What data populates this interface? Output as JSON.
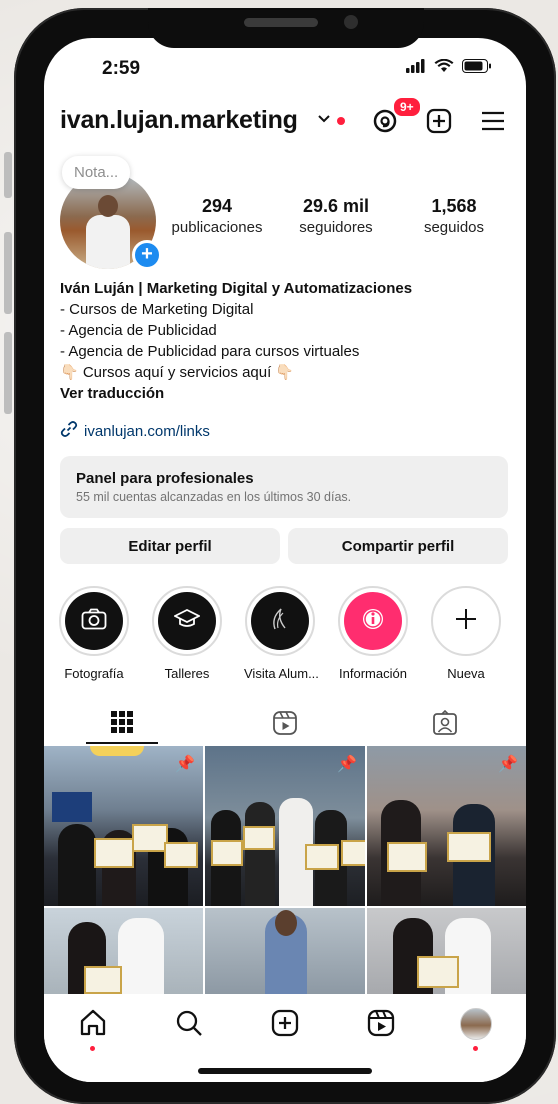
{
  "status_bar": {
    "time": "2:59"
  },
  "header": {
    "username": "ivan.lujan.marketing",
    "threads_badge": "9+"
  },
  "profile": {
    "note_placeholder": "Nota...",
    "stats": [
      {
        "value": "294",
        "label": "publicaciones"
      },
      {
        "value": "29.6 mil",
        "label": "seguidores"
      },
      {
        "value": "1,568",
        "label": "seguidos"
      }
    ],
    "bio": {
      "name": "Iván Luján | Marketing Digital y Automatizaciones",
      "lines": [
        "- Cursos de Marketing Digital",
        "- Agencia de Publicidad",
        "- Agencia de Publicidad para cursos virtuales",
        "👇🏻 Cursos aquí y servicios aquí 👇🏻"
      ],
      "translate": "Ver traducción"
    },
    "link": "ivanlujan.com/links"
  },
  "panel": {
    "title": "Panel para profesionales",
    "subtitle": "55 mil cuentas alcanzadas en los últimos 30 días."
  },
  "buttons": {
    "edit": "Editar perfil",
    "share": "Compartir perfil"
  },
  "highlights": [
    {
      "label": "Fotografía",
      "icon": "camera-icon"
    },
    {
      "label": "Talleres",
      "icon": "graduation-cap-icon"
    },
    {
      "label": "Visita Alum...",
      "icon": "feather-icon"
    },
    {
      "label": "Información",
      "icon": "info-icon",
      "color": "#ff2d6f"
    },
    {
      "label": "Nueva",
      "icon": "plus-icon"
    }
  ],
  "tabs": [
    "grid-icon",
    "reels-icon",
    "tagged-icon"
  ],
  "bottom_nav": [
    "home-icon",
    "search-icon",
    "create-icon",
    "reels-icon",
    "profile-avatar"
  ],
  "colors": {
    "accent_blue": "#1d8bf0",
    "notification_red": "#ff1f3d",
    "highlight_pink": "#ff2d6f"
  }
}
